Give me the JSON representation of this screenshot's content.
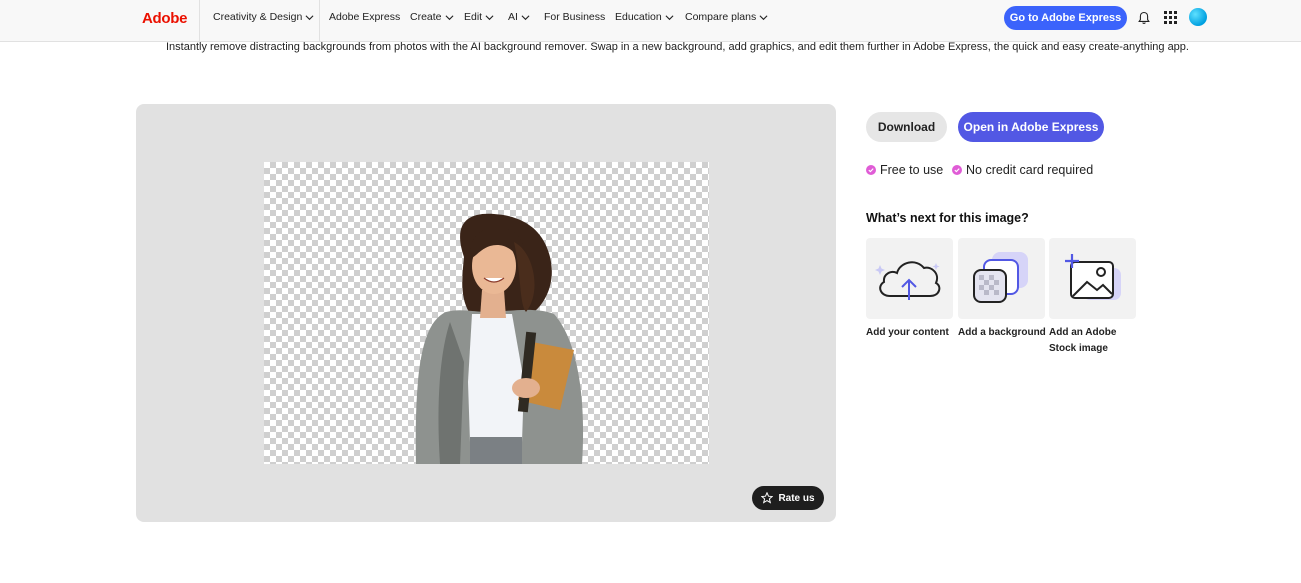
{
  "nav": {
    "brand": "Adobe",
    "items": [
      {
        "label": "Creativity & Design",
        "has_menu": true
      },
      {
        "label": "Adobe Express",
        "has_menu": false
      },
      {
        "label": "Create",
        "has_menu": true
      },
      {
        "label": "Edit",
        "has_menu": true
      },
      {
        "label": "AI",
        "has_menu": true
      },
      {
        "label": "For Business",
        "has_menu": false
      },
      {
        "label": "Education",
        "has_menu": true
      },
      {
        "label": "Compare plans",
        "has_menu": true
      }
    ],
    "cta_label": "Go to Adobe Express",
    "icons": [
      "bell-icon",
      "apps-grid-icon",
      "avatar"
    ],
    "colors": {
      "brand": "#eb1000",
      "cta": "#3b63fb"
    }
  },
  "description": "Instantly remove distracting backgrounds from photos with the AI background remover. Swap in a new background, add graphics, and edit them further in Adobe Express, the quick and easy create-anything app.",
  "preview": {
    "rate_label": "Rate us",
    "image_subject": "woman-holding-book-transparent-background"
  },
  "actions": {
    "download_label": "Download",
    "open_label": "Open in Adobe Express",
    "open_color": "#5258e4"
  },
  "perks": [
    {
      "label": "Free to use",
      "icon": "check-badge-icon"
    },
    {
      "label": "No credit card required",
      "icon": "check-badge-icon"
    }
  ],
  "next": {
    "title": "What’s next for this image?",
    "cards": [
      {
        "label": "Add your content",
        "icon": "cloud-upload-icon"
      },
      {
        "label": "Add a background",
        "icon": "layers-background-icon"
      },
      {
        "label": "Add an Adobe Stock image",
        "label_line1": "Add an Adobe",
        "label_line2": "Stock image",
        "icon": "add-image-icon"
      }
    ]
  }
}
